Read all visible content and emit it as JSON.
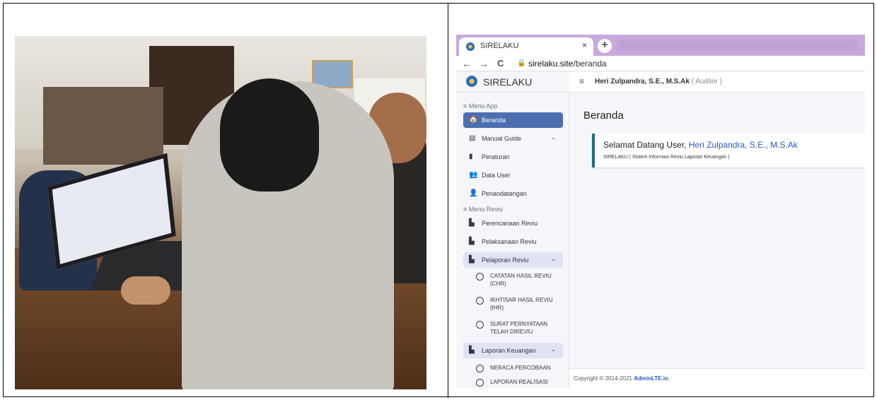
{
  "browser": {
    "tab_title": "SIRELAKU",
    "tab_close": "×",
    "new_tab": "+",
    "back": "←",
    "forward": "→",
    "reload": "C",
    "url_host": "sirelaku.site",
    "url_path": "/beranda"
  },
  "app": {
    "brand": "SIRELAKU",
    "user_name": "Heri Zulpandra, S.E., M.S.Ak",
    "user_role": "( Auditor )",
    "menu_header_app": "≡ Menu App",
    "menu_header_reviu": "≡ Menu Reviu",
    "menu": [
      {
        "label": "Beranda",
        "icon": "home-icon",
        "glyph": "🏠"
      },
      {
        "label": "Manual Guide",
        "icon": "book-icon",
        "glyph": "▤"
      },
      {
        "label": "Peraturan",
        "icon": "bookmark-icon",
        "glyph": "▮"
      },
      {
        "label": "Data User",
        "icon": "users-icon",
        "glyph": "👥"
      },
      {
        "label": "Penandatangan",
        "icon": "user-icon",
        "glyph": "👤"
      },
      {
        "label": "Perencanaan Reviu",
        "icon": "file-icon",
        "glyph": "▙"
      },
      {
        "label": "Pelaksanaan Reviu",
        "icon": "file-icon",
        "glyph": "▙"
      },
      {
        "label": "Pelaporan Reviu",
        "icon": "file-icon",
        "glyph": "▙"
      },
      {
        "label": "Laporan Keuangan",
        "icon": "file-invoice-icon",
        "glyph": "▙"
      }
    ],
    "caret": "⌄",
    "pelaporan_sub": [
      "CATATAN HASIL REVIU (CHR)",
      "IKHTISAR HASIL REVIU (IHR)",
      "SURAT PERNYATAAN TELAH DIREVIU"
    ],
    "laporan_sub": [
      "NERACA PERCOBAAN",
      "LAPORAN REALISASI"
    ],
    "page_title": "Beranda",
    "welcome_prefix": "Selamat Datang User, ",
    "welcome_name": "Heri Zulpandra, S.E., M.S.Ak",
    "welcome_subtitle": "SIRELAKU ( Sistem Informasi Reviu Laporan Keuangan )",
    "footer_prefix": "Copyright © 2014-2021 ",
    "footer_link": "AdminLTE.io",
    "footer_suffix": "."
  },
  "colors": {
    "active_menu": "#4b6fb1",
    "callout_border": "#1f6b85",
    "link": "#2b59c3",
    "tab_bar": "#c9a9dd"
  }
}
